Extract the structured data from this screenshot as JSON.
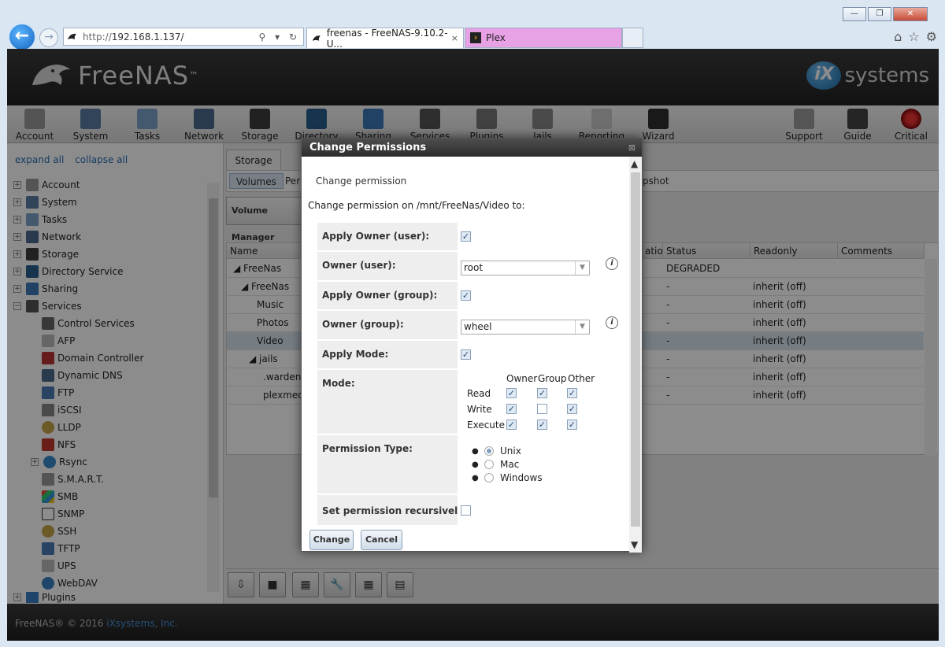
{
  "browser": {
    "address_prefix": "http://",
    "address_host": "192.168.1.137/",
    "tabs": [
      {
        "label": "freenas - FreeNAS-9.10.2-U..."
      },
      {
        "label": "Plex"
      }
    ],
    "tab_close": "×"
  },
  "header": {
    "logo_text": "FreeNAS",
    "logo_tm": "™",
    "vendor_text": "systems",
    "vendor_badge": "iX"
  },
  "toolbar": {
    "items": [
      {
        "label": "Account",
        "icon": "account-icon"
      },
      {
        "label": "System",
        "icon": "system-icon"
      },
      {
        "label": "Tasks",
        "icon": "tasks-icon"
      },
      {
        "label": "Network",
        "icon": "network-icon"
      },
      {
        "label": "Storage",
        "icon": "storage-icon"
      },
      {
        "label": "Directory",
        "icon": "directory-icon"
      },
      {
        "label": "Sharing",
        "icon": "sharing-icon"
      },
      {
        "label": "Services",
        "icon": "services-icon"
      },
      {
        "label": "Plugins",
        "icon": "plugins-icon"
      },
      {
        "label": "Jails",
        "icon": "jails-icon"
      },
      {
        "label": "Reporting",
        "icon": "reporting-icon"
      },
      {
        "label": "Wizard",
        "icon": "wizard-icon"
      },
      {
        "label": "Support",
        "icon": "support-icon"
      },
      {
        "label": "Guide",
        "icon": "guide-icon"
      },
      {
        "label": "Critical",
        "icon": "alert-icon"
      }
    ]
  },
  "tree": {
    "expand_all": "expand all",
    "collapse_all": "collapse all",
    "items": [
      {
        "label": "Account"
      },
      {
        "label": "System"
      },
      {
        "label": "Tasks"
      },
      {
        "label": "Network"
      },
      {
        "label": "Storage"
      },
      {
        "label": "Directory Service"
      },
      {
        "label": "Sharing"
      },
      {
        "label": "Services"
      },
      {
        "label": "Control Services"
      },
      {
        "label": "AFP"
      },
      {
        "label": "Domain Controller"
      },
      {
        "label": "Dynamic DNS"
      },
      {
        "label": "FTP"
      },
      {
        "label": "iSCSI"
      },
      {
        "label": "LLDP"
      },
      {
        "label": "NFS"
      },
      {
        "label": "Rsync"
      },
      {
        "label": "S.M.A.R.T."
      },
      {
        "label": "SMB"
      },
      {
        "label": "SNMP"
      },
      {
        "label": "SSH"
      },
      {
        "label": "TFTP"
      },
      {
        "label": "UPS"
      },
      {
        "label": "WebDAV"
      },
      {
        "label": "Plugins"
      }
    ]
  },
  "storage": {
    "tab_label": "Storage",
    "subtabs": [
      "Volumes",
      "Peri",
      "pshot"
    ],
    "volume_manager": "Volume Manager",
    "columns": [
      "Name",
      "atio",
      "Status",
      "Readonly",
      "Comments"
    ],
    "rows": [
      {
        "name": "FreeNas",
        "status": "DEGRADED",
        "readonly": ""
      },
      {
        "name": "FreeNas",
        "status": "-",
        "readonly": "inherit (off)"
      },
      {
        "name": "Music",
        "status": "-",
        "readonly": "inherit (off)"
      },
      {
        "name": "Photos",
        "status": "-",
        "readonly": "inherit (off)"
      },
      {
        "name": "Video",
        "status": "-",
        "readonly": "inherit (off)"
      },
      {
        "name": "jails",
        "status": "-",
        "readonly": "inherit (off)"
      },
      {
        "name": ".warden-",
        "status": "-",
        "readonly": "inherit (off)"
      },
      {
        "name": "plexmedi",
        "status": "-",
        "readonly": "inherit (off)"
      }
    ]
  },
  "footer": {
    "copyright": "FreeNAS® © 2016 ",
    "company": "iXsystems, Inc."
  },
  "dialog": {
    "title": "Change Permissions",
    "close": "⊠",
    "header": "Change permission",
    "description": "Change permission on /mnt/FreeNas/Video to:",
    "apply_owner_user_label": "Apply Owner (user):",
    "owner_user_label": "Owner (user):",
    "owner_user_value": "root",
    "apply_owner_group_label": "Apply Owner (group):",
    "owner_group_label": "Owner (group):",
    "owner_group_value": "wheel",
    "apply_mode_label": "Apply Mode:",
    "mode_label": "Mode:",
    "mode_cols": [
      "Owner",
      "Group",
      "Other"
    ],
    "mode_rows": [
      "Read",
      "Write",
      "Execute"
    ],
    "permission_type_label": "Permission Type:",
    "permission_types": [
      "Unix",
      "Mac",
      "Windows"
    ],
    "selected_permission_type": "Unix",
    "recursive_label": "Set permission recursively:",
    "change_button": "Change",
    "cancel_button": "Cancel",
    "checks": {
      "apply_owner_user": true,
      "apply_owner_group": true,
      "apply_mode": true,
      "recursive": false,
      "read": [
        true,
        true,
        true
      ],
      "write": [
        true,
        false,
        true
      ],
      "execute": [
        true,
        true,
        true
      ]
    }
  }
}
